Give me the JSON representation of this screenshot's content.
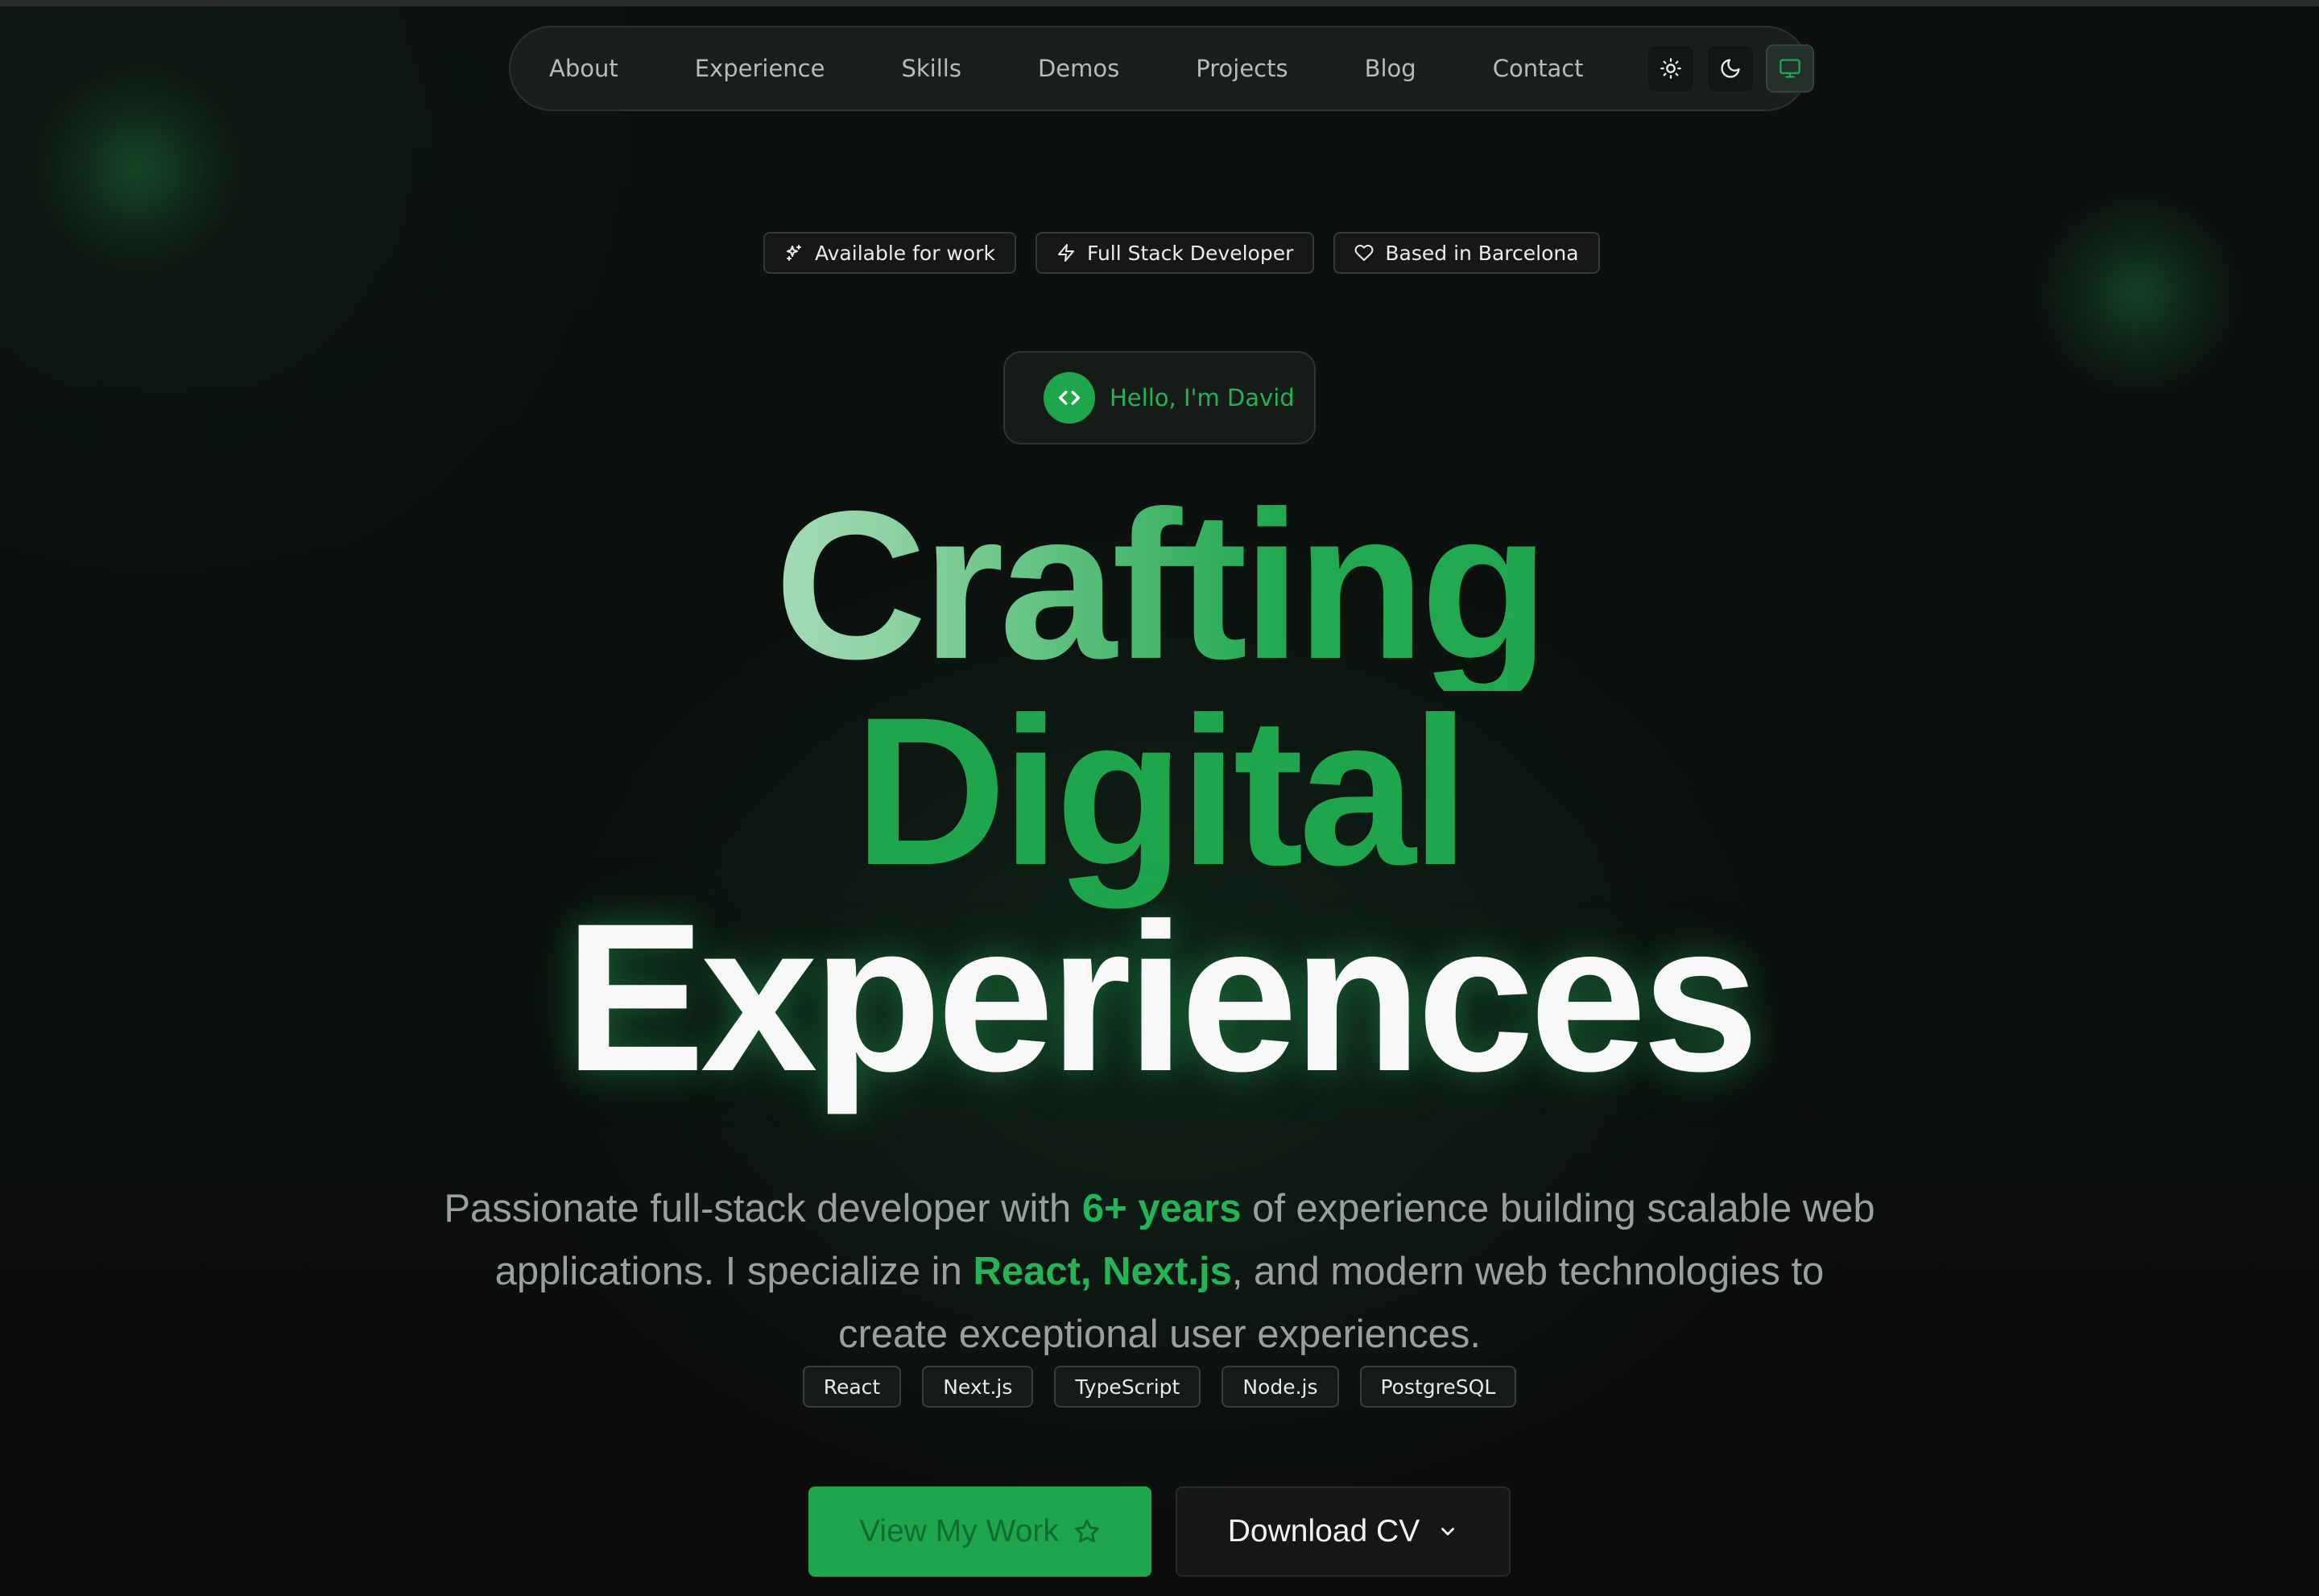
{
  "nav": {
    "items": [
      {
        "label": "About"
      },
      {
        "label": "Experience"
      },
      {
        "label": "Skills"
      },
      {
        "label": "Demos"
      },
      {
        "label": "Projects"
      },
      {
        "label": "Blog"
      },
      {
        "label": "Contact"
      }
    ],
    "theme_buttons": [
      {
        "icon": "sun-icon",
        "active": false
      },
      {
        "icon": "moon-icon",
        "active": false
      },
      {
        "icon": "monitor-icon",
        "active": true
      }
    ]
  },
  "badges": [
    {
      "icon": "sparkles-icon",
      "label": "Available for work"
    },
    {
      "icon": "zap-icon",
      "label": "Full Stack Developer"
    },
    {
      "icon": "heart-icon",
      "label": "Based in Barcelona"
    }
  ],
  "hello": {
    "icon": "code-icon",
    "text": "Hello, I'm David"
  },
  "headline": {
    "line1": "Crafting",
    "line2": "Digital",
    "line3": "Experiences"
  },
  "intro": {
    "part1": "Passionate full-stack developer with ",
    "highlight1": "6+ years",
    "part2": " of experience building scalable web applications. I specialize in ",
    "highlight2": "React, Next.js",
    "part3": ", and modern web technologies to create exceptional user experiences."
  },
  "tech_tags": [
    {
      "label": "React"
    },
    {
      "label": "Next.js"
    },
    {
      "label": "TypeScript"
    },
    {
      "label": "Node.js"
    },
    {
      "label": "PostgreSQL"
    }
  ],
  "cta": {
    "primary_label": "View My Work",
    "primary_icon": "star-icon",
    "secondary_label": "Download CV",
    "secondary_icon": "chevron-down-icon"
  },
  "colors": {
    "accent": "#1fa64d",
    "background": "#0b0f0d",
    "muted_text": "#9aa09d"
  }
}
